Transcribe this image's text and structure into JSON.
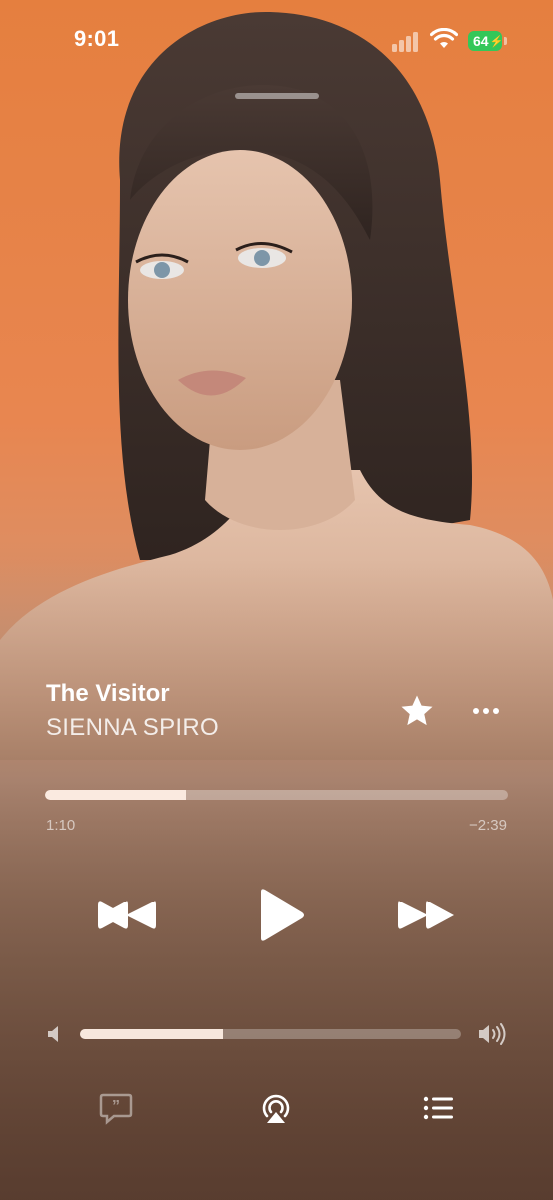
{
  "status_bar": {
    "time": "9:01",
    "battery": "64"
  },
  "now_playing": {
    "title": "The Visitor",
    "artist": "SIENNA SPIRO",
    "progress_fraction": 0.305,
    "elapsed": "1:10",
    "remaining": "−2:39",
    "volume_fraction": 0.375
  },
  "icons": {
    "favorite": "star-icon",
    "more": "more-icon",
    "rewind": "rewind-icon",
    "play": "play-icon",
    "forward": "fast-forward-icon",
    "volume_low": "speaker-low-icon",
    "volume_high": "speaker-high-icon",
    "lyrics": "lyrics-icon",
    "airplay": "airplay-icon",
    "queue": "queue-icon"
  },
  "colors": {
    "background_top": "#e57f3f",
    "background_bottom": "#6d4c3b",
    "battery": "#34c759"
  }
}
